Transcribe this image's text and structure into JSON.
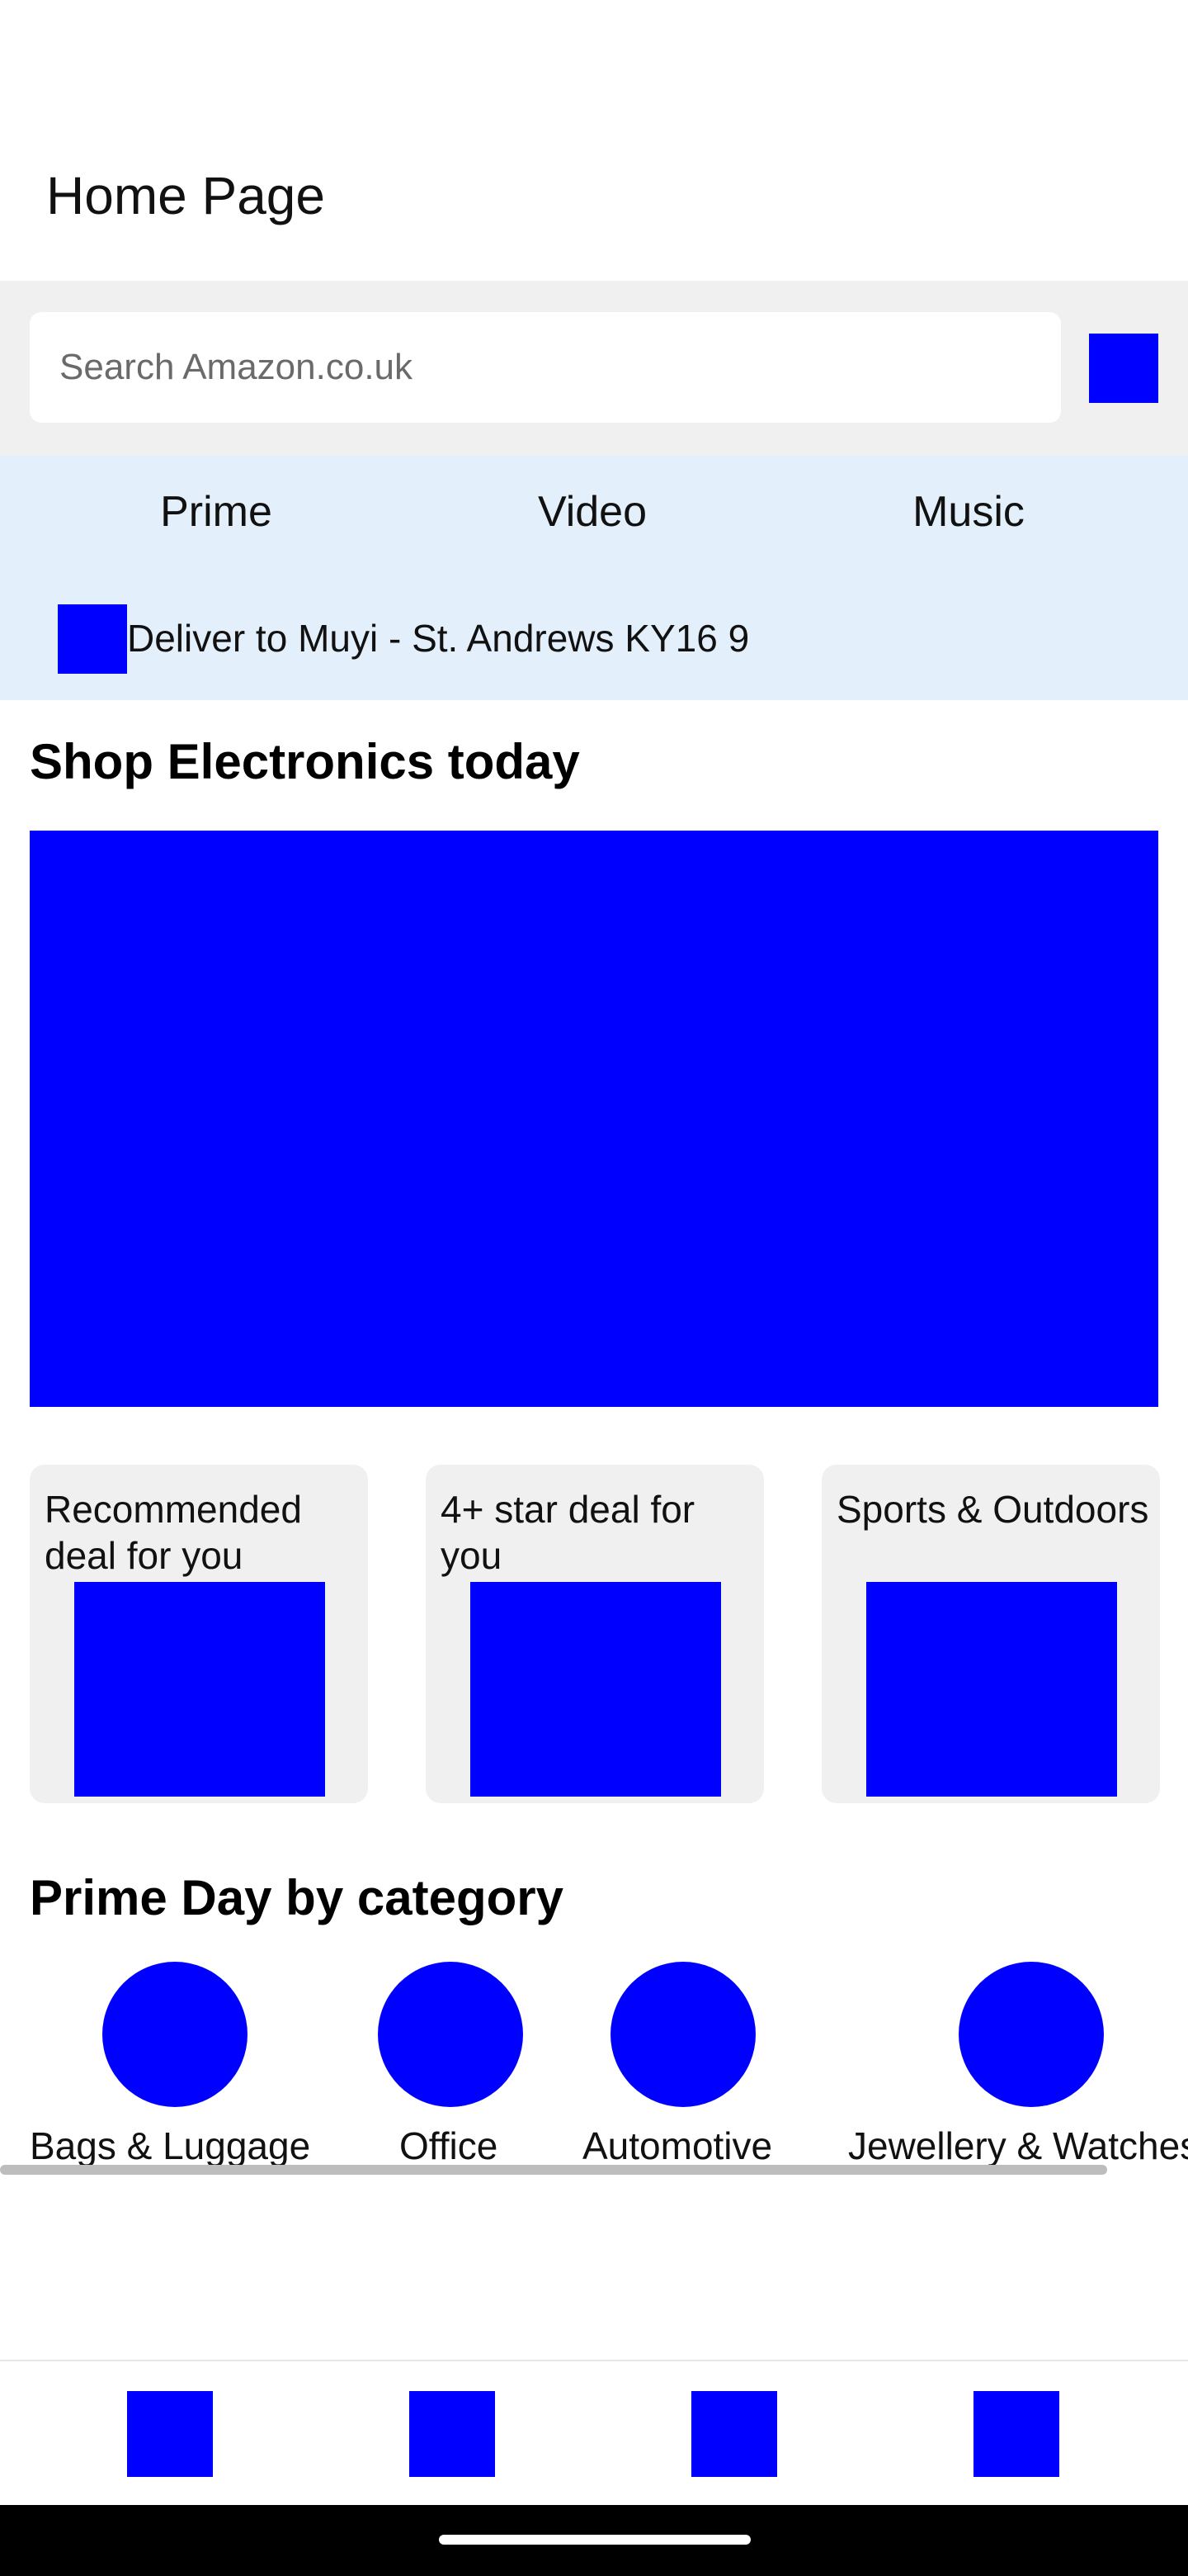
{
  "header": {
    "title": "Home Page"
  },
  "search": {
    "placeholder": "Search Amazon.co.uk",
    "button_icon": "search-icon"
  },
  "tabs": [
    {
      "label": "Prime"
    },
    {
      "label": "Video"
    },
    {
      "label": "Music"
    }
  ],
  "deliver": {
    "text": "Deliver to Muyi - St. Andrews KY16 9",
    "icon": "location-pin-icon"
  },
  "sections": {
    "electronics": {
      "title": "Shop Electronics today"
    },
    "prime_day": {
      "title": "Prime Day by category",
      "categories": [
        {
          "label": "Bags & Luggage"
        },
        {
          "label": "Office"
        },
        {
          "label": "Automotive"
        },
        {
          "label": "Jewellery & Watches"
        }
      ]
    }
  },
  "cards": [
    {
      "title": "Recommended deal for you"
    },
    {
      "title": "4+ star deal for you"
    },
    {
      "title": "Sports & Outdoors"
    }
  ],
  "bottom_nav": [
    {
      "icon": "home-icon"
    },
    {
      "icon": "account-icon"
    },
    {
      "icon": "cart-icon"
    },
    {
      "icon": "menu-icon"
    }
  ],
  "colors": {
    "accent": "#0000ff",
    "tab_band": "#e3f0fb",
    "search_band": "#f0f0f0"
  }
}
